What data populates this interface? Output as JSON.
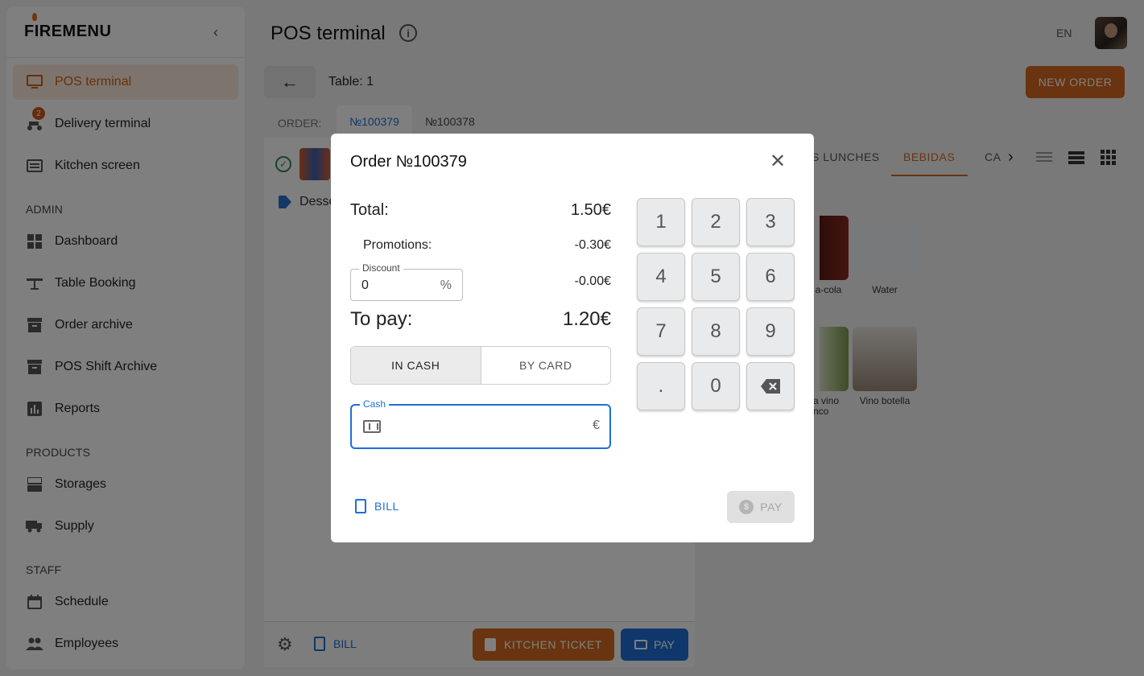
{
  "sidebar": {
    "logo": "FIREMENU",
    "items": [
      {
        "label": "POS terminal"
      },
      {
        "label": "Delivery terminal",
        "badge": "2"
      },
      {
        "label": "Kitchen screen"
      },
      {
        "label": "Dashboard"
      },
      {
        "label": "Table Booking"
      },
      {
        "label": "Order archive"
      },
      {
        "label": "POS Shift Archive"
      },
      {
        "label": "Reports"
      },
      {
        "label": "Storages"
      },
      {
        "label": "Supply"
      },
      {
        "label": "Schedule"
      },
      {
        "label": "Employees"
      }
    ],
    "sections": [
      "ADMIN",
      "PRODUCTS",
      "STAFF"
    ]
  },
  "header": {
    "title": "POS terminal",
    "lang": "EN"
  },
  "toolbar": {
    "table_label": "Table: 1",
    "new_order": "NEW ORDER"
  },
  "orders": {
    "label": "ORDER:",
    "tabs": [
      "№100379",
      "№100378"
    ]
  },
  "order_panel": {
    "category": "Desse",
    "bill": "BILL",
    "kitchen_ticket": "KITCHEN TICKET",
    "pay": "PAY"
  },
  "catalog": {
    "tabs": [
      "S LUNCHES",
      "BEBIDAS",
      "CA"
    ],
    "products": [
      {
        "name": "a-cola"
      },
      {
        "name": "Water"
      },
      {
        "name": "a vino\nnco"
      },
      {
        "name": "Vino botella"
      }
    ]
  },
  "modal": {
    "title": "Order №100379",
    "total_label": "Total:",
    "total_value": "1.50€",
    "promotions_label": "Promotions:",
    "promotions_value": "-0.30€",
    "discount_label": "Discount",
    "discount_value": "0",
    "discount_unit": "%",
    "discount_amount": "-0.00€",
    "to_pay_label": "To pay:",
    "to_pay_value": "1.20€",
    "payment_methods": [
      "IN CASH",
      "BY CARD"
    ],
    "cash_label": "Cash",
    "cash_unit": "€",
    "keypad": [
      "1",
      "2",
      "3",
      "4",
      "5",
      "6",
      "7",
      "8",
      "9",
      ".",
      "0"
    ],
    "bill": "BILL",
    "pay": "PAY"
  },
  "colors": {
    "accent": "#d2691e",
    "primary": "#1e6fd9"
  }
}
